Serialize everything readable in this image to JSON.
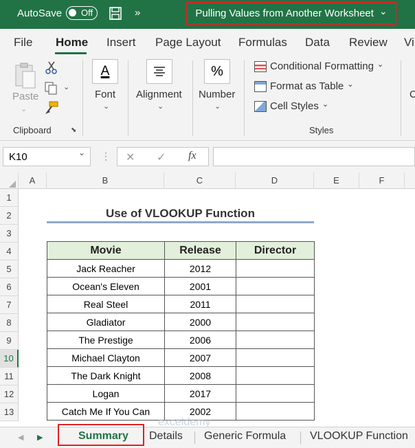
{
  "titlebar": {
    "autosave_label": "AutoSave",
    "toggle_state": "Off",
    "more_glyph": "»",
    "document_title": "Pulling Values from Another Worksheet",
    "title_chevron": "⌄",
    "color": "#217346"
  },
  "ribbon_tabs": [
    "File",
    "Home",
    "Insert",
    "Page Layout",
    "Formulas",
    "Data",
    "Review",
    "Vi"
  ],
  "ribbon": {
    "clipboard": {
      "paste": "Paste",
      "group": "Clipboard"
    },
    "font": {
      "label": "Font",
      "icon_glyph": "A"
    },
    "alignment": {
      "label": "Alignment"
    },
    "number": {
      "label": "Number",
      "icon_glyph": "%"
    },
    "styles": {
      "conditional": "Conditional Formatting",
      "format_table": "Format as Table",
      "cell_styles": "Cell Styles",
      "group": "Styles",
      "chevron": "⌄"
    }
  },
  "formula_bar": {
    "name_box": "K10",
    "cancel": "✕",
    "enter": "✓",
    "fx": "fx",
    "dropdown": "⌄"
  },
  "columns": [
    "A",
    "B",
    "C",
    "D",
    "E",
    "F"
  ],
  "rows": [
    "1",
    "2",
    "3",
    "4",
    "5",
    "6",
    "7",
    "8",
    "9",
    "10",
    "11",
    "12",
    "13"
  ],
  "sheet": {
    "title": "Use of VLOOKUP Function",
    "headers": [
      "Movie",
      "Release",
      "Director"
    ],
    "data": [
      [
        "Jack Reacher",
        "2012",
        ""
      ],
      [
        "Ocean's Eleven",
        "2001",
        ""
      ],
      [
        "Real Steel",
        "2011",
        ""
      ],
      [
        "Gladiator",
        "2000",
        ""
      ],
      [
        "The Prestige",
        "2006",
        ""
      ],
      [
        "Michael Clayton",
        "2007",
        ""
      ],
      [
        "The Dark Knight",
        "2008",
        ""
      ],
      [
        "Logan",
        "2017",
        ""
      ],
      [
        "Catch Me If You Can",
        "2002",
        ""
      ]
    ]
  },
  "sheet_tabs": [
    "Summary",
    "Details",
    "Generic Formula",
    "VLOOKUP Function"
  ],
  "watermark": "exceldemy"
}
